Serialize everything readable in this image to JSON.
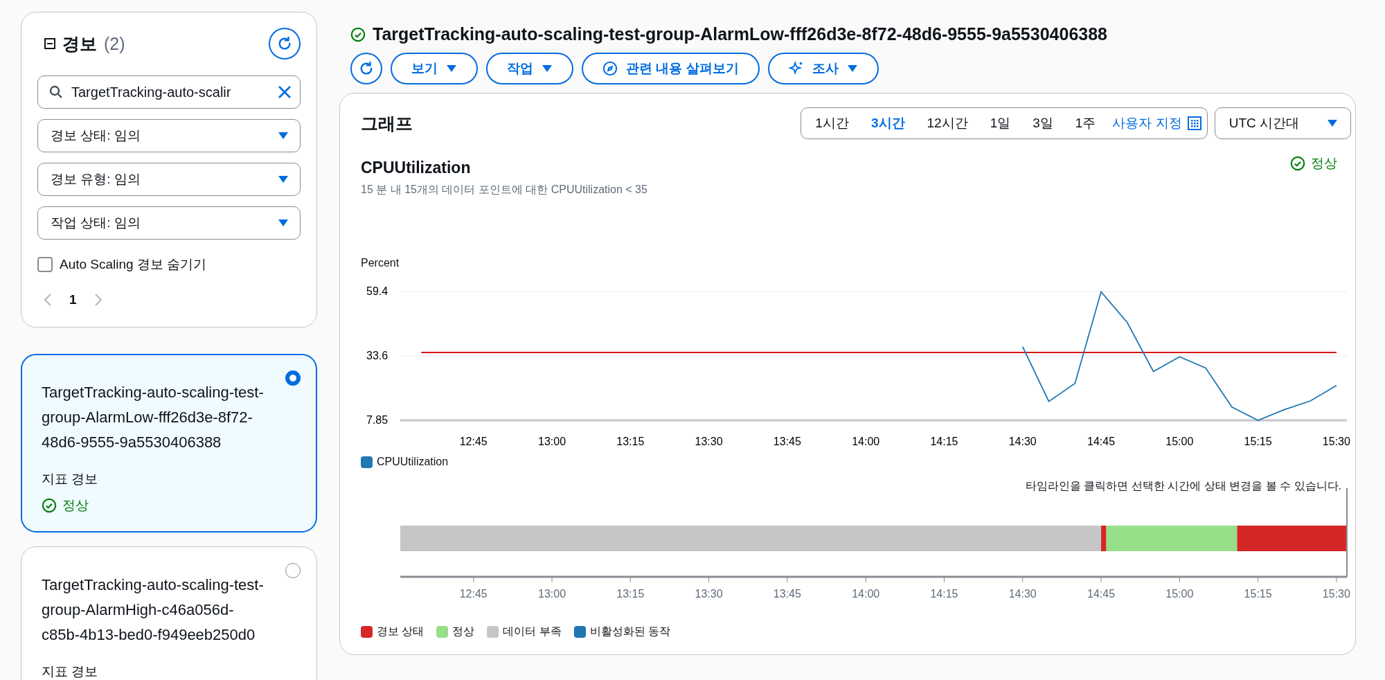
{
  "sidebar": {
    "title": "경보",
    "count": "(2)",
    "search": {
      "value": "TargetTracking-auto-scalir"
    },
    "filters": [
      {
        "label": "경보 상태: 임의"
      },
      {
        "label": "경보 유형: 임의"
      },
      {
        "label": "작업 상태: 임의"
      }
    ],
    "hide_autoscaling": {
      "label": "Auto Scaling 경보 숨기기",
      "checked": false
    },
    "pagination": {
      "page": "1"
    },
    "alarms": [
      {
        "name": "TargetTracking-auto-scaling-test-group-AlarmLow-fff26d3e-8f72-48d6-9555-9a5530406388",
        "type": "지표 경보",
        "status": "정상",
        "selected": true
      },
      {
        "name": "TargetTracking-auto-scaling-test-group-AlarmHigh-c46a056d-c85b-4b13-bed0-f949eeb250d0",
        "type": "지표 경보",
        "selected": false
      }
    ]
  },
  "header": {
    "title": "TargetTracking-auto-scaling-test-group-AlarmLow-fff26d3e-8f72-48d6-9555-9a5530406388",
    "actions": [
      {
        "label": "보기",
        "kind": "dropdown"
      },
      {
        "label": "작업",
        "kind": "dropdown"
      },
      {
        "label": "관련 내용 살펴보기",
        "kind": "compass"
      },
      {
        "label": "조사",
        "kind": "sparkle"
      }
    ]
  },
  "graph": {
    "title": "그래프",
    "ranges": [
      {
        "label": "1시간",
        "selected": false
      },
      {
        "label": "3시간",
        "selected": true
      },
      {
        "label": "12시간",
        "selected": false
      },
      {
        "label": "1일",
        "selected": false
      },
      {
        "label": "3일",
        "selected": false
      },
      {
        "label": "1주",
        "selected": false
      }
    ],
    "custom_range": "사용자 지정",
    "timezone": "UTC 시간대",
    "metric": "CPUUtilization",
    "status": "정상",
    "description": "15 분 내 15개의 데이터 포인트에 대한 CPUUtilization < 35",
    "chart_data": {
      "type": "line",
      "ylabel": "Percent",
      "categories": [
        null,
        null,
        "12:45",
        null,
        null,
        "13:00",
        null,
        null,
        "13:15",
        null,
        null,
        "13:30",
        null,
        null,
        "13:45",
        null,
        null,
        "14:00",
        null,
        null,
        "14:15",
        null,
        null,
        "14:30",
        null,
        null,
        "14:45",
        null,
        null,
        "15:00",
        null,
        null,
        "15:15",
        null,
        null,
        "15:30"
      ],
      "series": [
        {
          "name": "CPUUtilization",
          "color": "#1f77b4",
          "values": [
            null,
            null,
            null,
            null,
            null,
            null,
            null,
            null,
            null,
            null,
            null,
            null,
            null,
            null,
            null,
            null,
            null,
            null,
            null,
            null,
            null,
            null,
            null,
            37.3,
            15.4,
            22.6,
            59.3,
            47.0,
            27.4,
            33.3,
            28.8,
            13.2,
            7.85,
            12.1,
            15.6,
            21.8
          ]
        },
        {
          "color": "#d91515",
          "values": [
            35,
            35,
            35,
            35,
            35,
            35,
            35,
            35,
            35,
            35,
            35,
            35,
            35,
            35,
            35,
            35,
            35,
            35,
            35,
            35,
            35,
            35,
            35,
            35,
            35,
            35,
            35,
            35,
            35,
            35,
            35,
            35,
            35,
            35,
            35,
            35
          ]
        }
      ],
      "ylim": [
        7.85,
        59.4
      ],
      "yticks": [
        7.85,
        33.6,
        59.4
      ]
    },
    "timeline_hint": "타임라인을 클릭하면 선택한 시간에 상태 변경을 볼 수 있습니다.",
    "timeline": {
      "axis_labels": [
        "12:45",
        "13:00",
        "13:15",
        "13:30",
        "13:45",
        "14:00",
        "14:15",
        "14:30",
        "14:45",
        "15:00",
        "15:15",
        "15:30"
      ]
    },
    "legend": [
      {
        "label": "경보 상태",
        "color": "#d62728"
      },
      {
        "label": "정상",
        "color": "#98df8a"
      },
      {
        "label": "데이터 부족",
        "color": "#c6c6c6"
      },
      {
        "label": "비활성화된 동작",
        "color": "#1f77b4"
      }
    ]
  }
}
